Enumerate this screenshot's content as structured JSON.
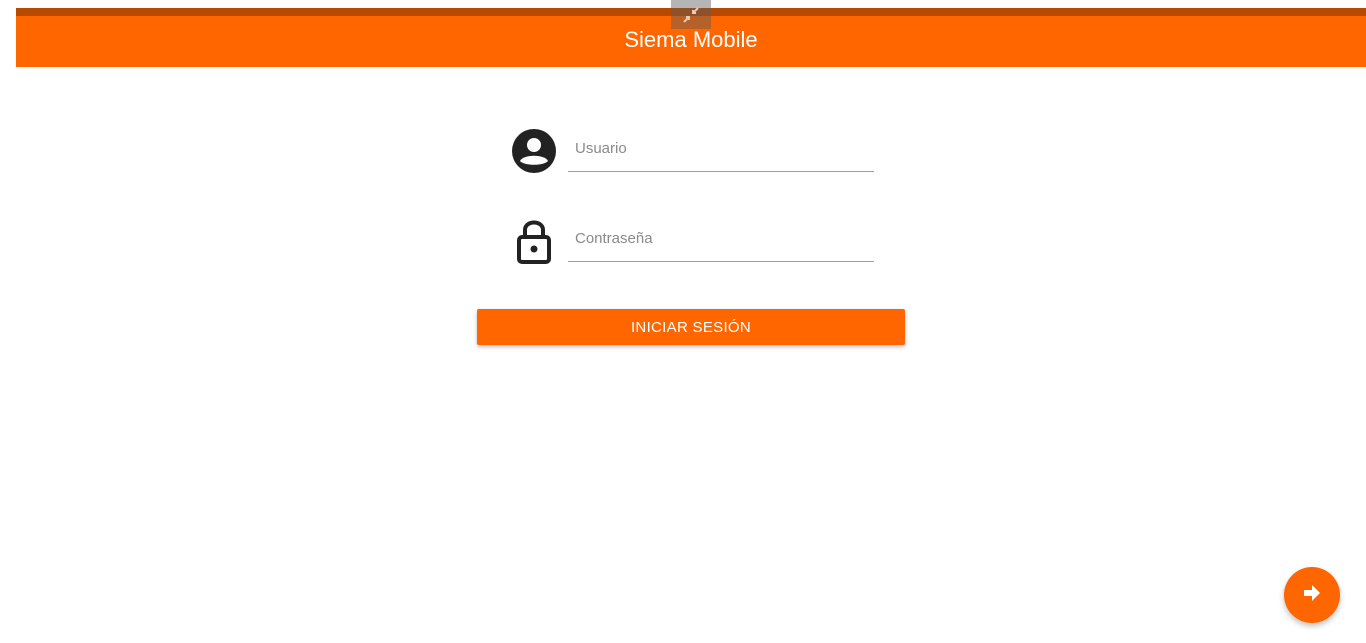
{
  "app": {
    "title": "Siema Mobile"
  },
  "header": {
    "collapse_icon": "collapse-arrows-icon"
  },
  "login_form": {
    "username": {
      "icon": "account-circle-icon",
      "placeholder": "Usuario",
      "value": ""
    },
    "password": {
      "icon": "lock-icon",
      "placeholder": "Contraseña",
      "value": ""
    },
    "submit_label": "INICIAR SESIÓN"
  },
  "fab": {
    "icon": "arrow-right-icon"
  },
  "colors": {
    "primary": "#ff6600",
    "primary_dark": "#b84a00",
    "icon_dark": "#222222"
  }
}
